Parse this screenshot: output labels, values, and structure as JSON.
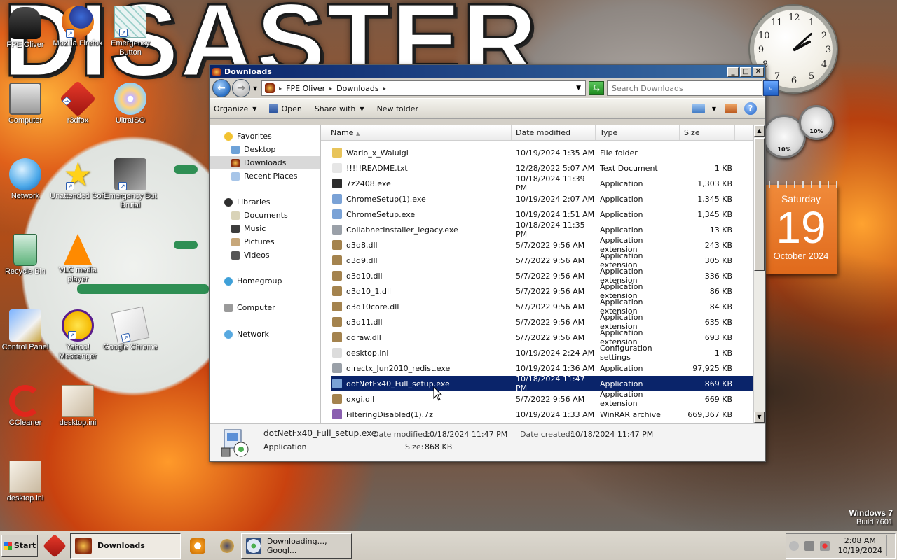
{
  "desktop": {
    "wallpaper_title": "DISASTER",
    "os_brand": "Windows 7",
    "os_build": "Build 7601",
    "icons": [
      {
        "label": "FPE Oliver"
      },
      {
        "label": "Mozilla Firefox"
      },
      {
        "label": "Emergency Button"
      },
      {
        "label": "Computer"
      },
      {
        "label": "r3dfox"
      },
      {
        "label": "UltraISO"
      },
      {
        "label": "Network"
      },
      {
        "label": "Unattended Soft"
      },
      {
        "label": "Emergency But Brutal"
      },
      {
        "label": "Recycle Bin"
      },
      {
        "label": "VLC media player"
      },
      {
        "label": "Control Panel"
      },
      {
        "label": "Yahoo! Messenger"
      },
      {
        "label": "Google Chrome"
      },
      {
        "label": "CCleaner"
      },
      {
        "label": "desktop.ini"
      },
      {
        "label": "desktop.ini"
      }
    ]
  },
  "gadgets": {
    "clock": {
      "numbers": [
        "12",
        "1",
        "2",
        "3",
        "4",
        "5",
        "6",
        "7",
        "8",
        "9",
        "10",
        "11"
      ]
    },
    "meters": {
      "cpu": "10%",
      "memory": "10%"
    },
    "calendar": {
      "day_name": "Saturday",
      "day": "19",
      "month_year": "October 2024"
    }
  },
  "window": {
    "title": "Downloads",
    "controls": {
      "minimize": "_",
      "maximize": "□",
      "close": "✕"
    },
    "address": {
      "crumbs": [
        "FPE Oliver",
        "Downloads"
      ]
    },
    "search": {
      "placeholder": "Search Downloads"
    },
    "toolbar": {
      "organize": "Organize",
      "open": "Open",
      "share_with": "Share with",
      "new_folder": "New folder",
      "help": "?"
    },
    "nav": {
      "favorites": "Favorites",
      "favorites_items": [
        "Desktop",
        "Downloads",
        "Recent Places"
      ],
      "libraries": "Libraries",
      "libraries_items": [
        "Documents",
        "Music",
        "Pictures",
        "Videos"
      ],
      "homegroup": "Homegroup",
      "computer": "Computer",
      "network": "Network"
    },
    "columns": {
      "name": "Name",
      "date": "Date modified",
      "type": "Type",
      "size": "Size"
    },
    "files": [
      {
        "name": "Wario_x_Waluigi",
        "date": "10/19/2024 1:35 AM",
        "type": "File folder",
        "size": "",
        "icon": "folder",
        "color": "#e8c45a"
      },
      {
        "name": "!!!!!README.txt",
        "date": "12/28/2022 5:07 AM",
        "type": "Text Document",
        "size": "1 KB",
        "icon": "text",
        "color": "#e6e6e6"
      },
      {
        "name": "7z2408.exe",
        "date": "10/18/2024 11:39 PM",
        "type": "Application",
        "size": "1,303 KB",
        "icon": "7z",
        "color": "#2d2d2d"
      },
      {
        "name": "ChromeSetup(1).exe",
        "date": "10/19/2024 2:07 AM",
        "type": "Application",
        "size": "1,345 KB",
        "icon": "setup",
        "color": "#7aa2d6"
      },
      {
        "name": "ChromeSetup.exe",
        "date": "10/19/2024 1:51 AM",
        "type": "Application",
        "size": "1,345 KB",
        "icon": "setup",
        "color": "#7aa2d6"
      },
      {
        "name": "CollabnetInstaller_legacy.exe",
        "date": "10/18/2024 11:35 PM",
        "type": "Application",
        "size": "13 KB",
        "icon": "app",
        "color": "#9aa0a8"
      },
      {
        "name": "d3d8.dll",
        "date": "5/7/2022 9:56 AM",
        "type": "Application extension",
        "size": "243 KB",
        "icon": "dll",
        "color": "#a4834e"
      },
      {
        "name": "d3d9.dll",
        "date": "5/7/2022 9:56 AM",
        "type": "Application extension",
        "size": "305 KB",
        "icon": "dll",
        "color": "#a4834e"
      },
      {
        "name": "d3d10.dll",
        "date": "5/7/2022 9:56 AM",
        "type": "Application extension",
        "size": "336 KB",
        "icon": "dll",
        "color": "#a4834e"
      },
      {
        "name": "d3d10_1.dll",
        "date": "5/7/2022 9:56 AM",
        "type": "Application extension",
        "size": "86 KB",
        "icon": "dll",
        "color": "#a4834e"
      },
      {
        "name": "d3d10core.dll",
        "date": "5/7/2022 9:56 AM",
        "type": "Application extension",
        "size": "84 KB",
        "icon": "dll",
        "color": "#a4834e"
      },
      {
        "name": "d3d11.dll",
        "date": "5/7/2022 9:56 AM",
        "type": "Application extension",
        "size": "635 KB",
        "icon": "dll",
        "color": "#a4834e"
      },
      {
        "name": "ddraw.dll",
        "date": "5/7/2022 9:56 AM",
        "type": "Application extension",
        "size": "693 KB",
        "icon": "dll",
        "color": "#a4834e"
      },
      {
        "name": "desktop.ini",
        "date": "10/19/2024 2:24 AM",
        "type": "Configuration settings",
        "size": "1 KB",
        "icon": "ini",
        "color": "#dcdcdc"
      },
      {
        "name": "directx_Jun2010_redist.exe",
        "date": "10/19/2024 1:36 AM",
        "type": "Application",
        "size": "97,925 KB",
        "icon": "app",
        "color": "#9aa0a8"
      },
      {
        "name": "dotNetFx40_Full_setup.exe",
        "date": "10/18/2024 11:47 PM",
        "type": "Application",
        "size": "869 KB",
        "icon": "setup",
        "color": "#7aa2d6",
        "selected": true
      },
      {
        "name": "dxgi.dll",
        "date": "5/7/2022 9:56 AM",
        "type": "Application extension",
        "size": "669 KB",
        "icon": "dll",
        "color": "#a4834e"
      },
      {
        "name": "FilteringDisabled(1).7z",
        "date": "10/19/2024 1:33 AM",
        "type": "WinRAR archive",
        "size": "669,367 KB",
        "icon": "rar",
        "color": "#8a5fb0"
      }
    ],
    "details": {
      "name": "dotNetFx40_Full_setup.exe",
      "type": "Application",
      "modified_label": "Date modified:",
      "modified": "10/18/2024 11:47 PM",
      "created_label": "Date created:",
      "created": "10/18/2024 11:47 PM",
      "size_label": "Size:",
      "size": "868 KB"
    }
  },
  "taskbar": {
    "start": "Start",
    "tasks": [
      {
        "label": "Downloads",
        "active": true
      },
      {
        "label": "Downloading..., Googl...",
        "active": false
      }
    ],
    "time": "2:08 AM",
    "date": "10/19/2024"
  }
}
